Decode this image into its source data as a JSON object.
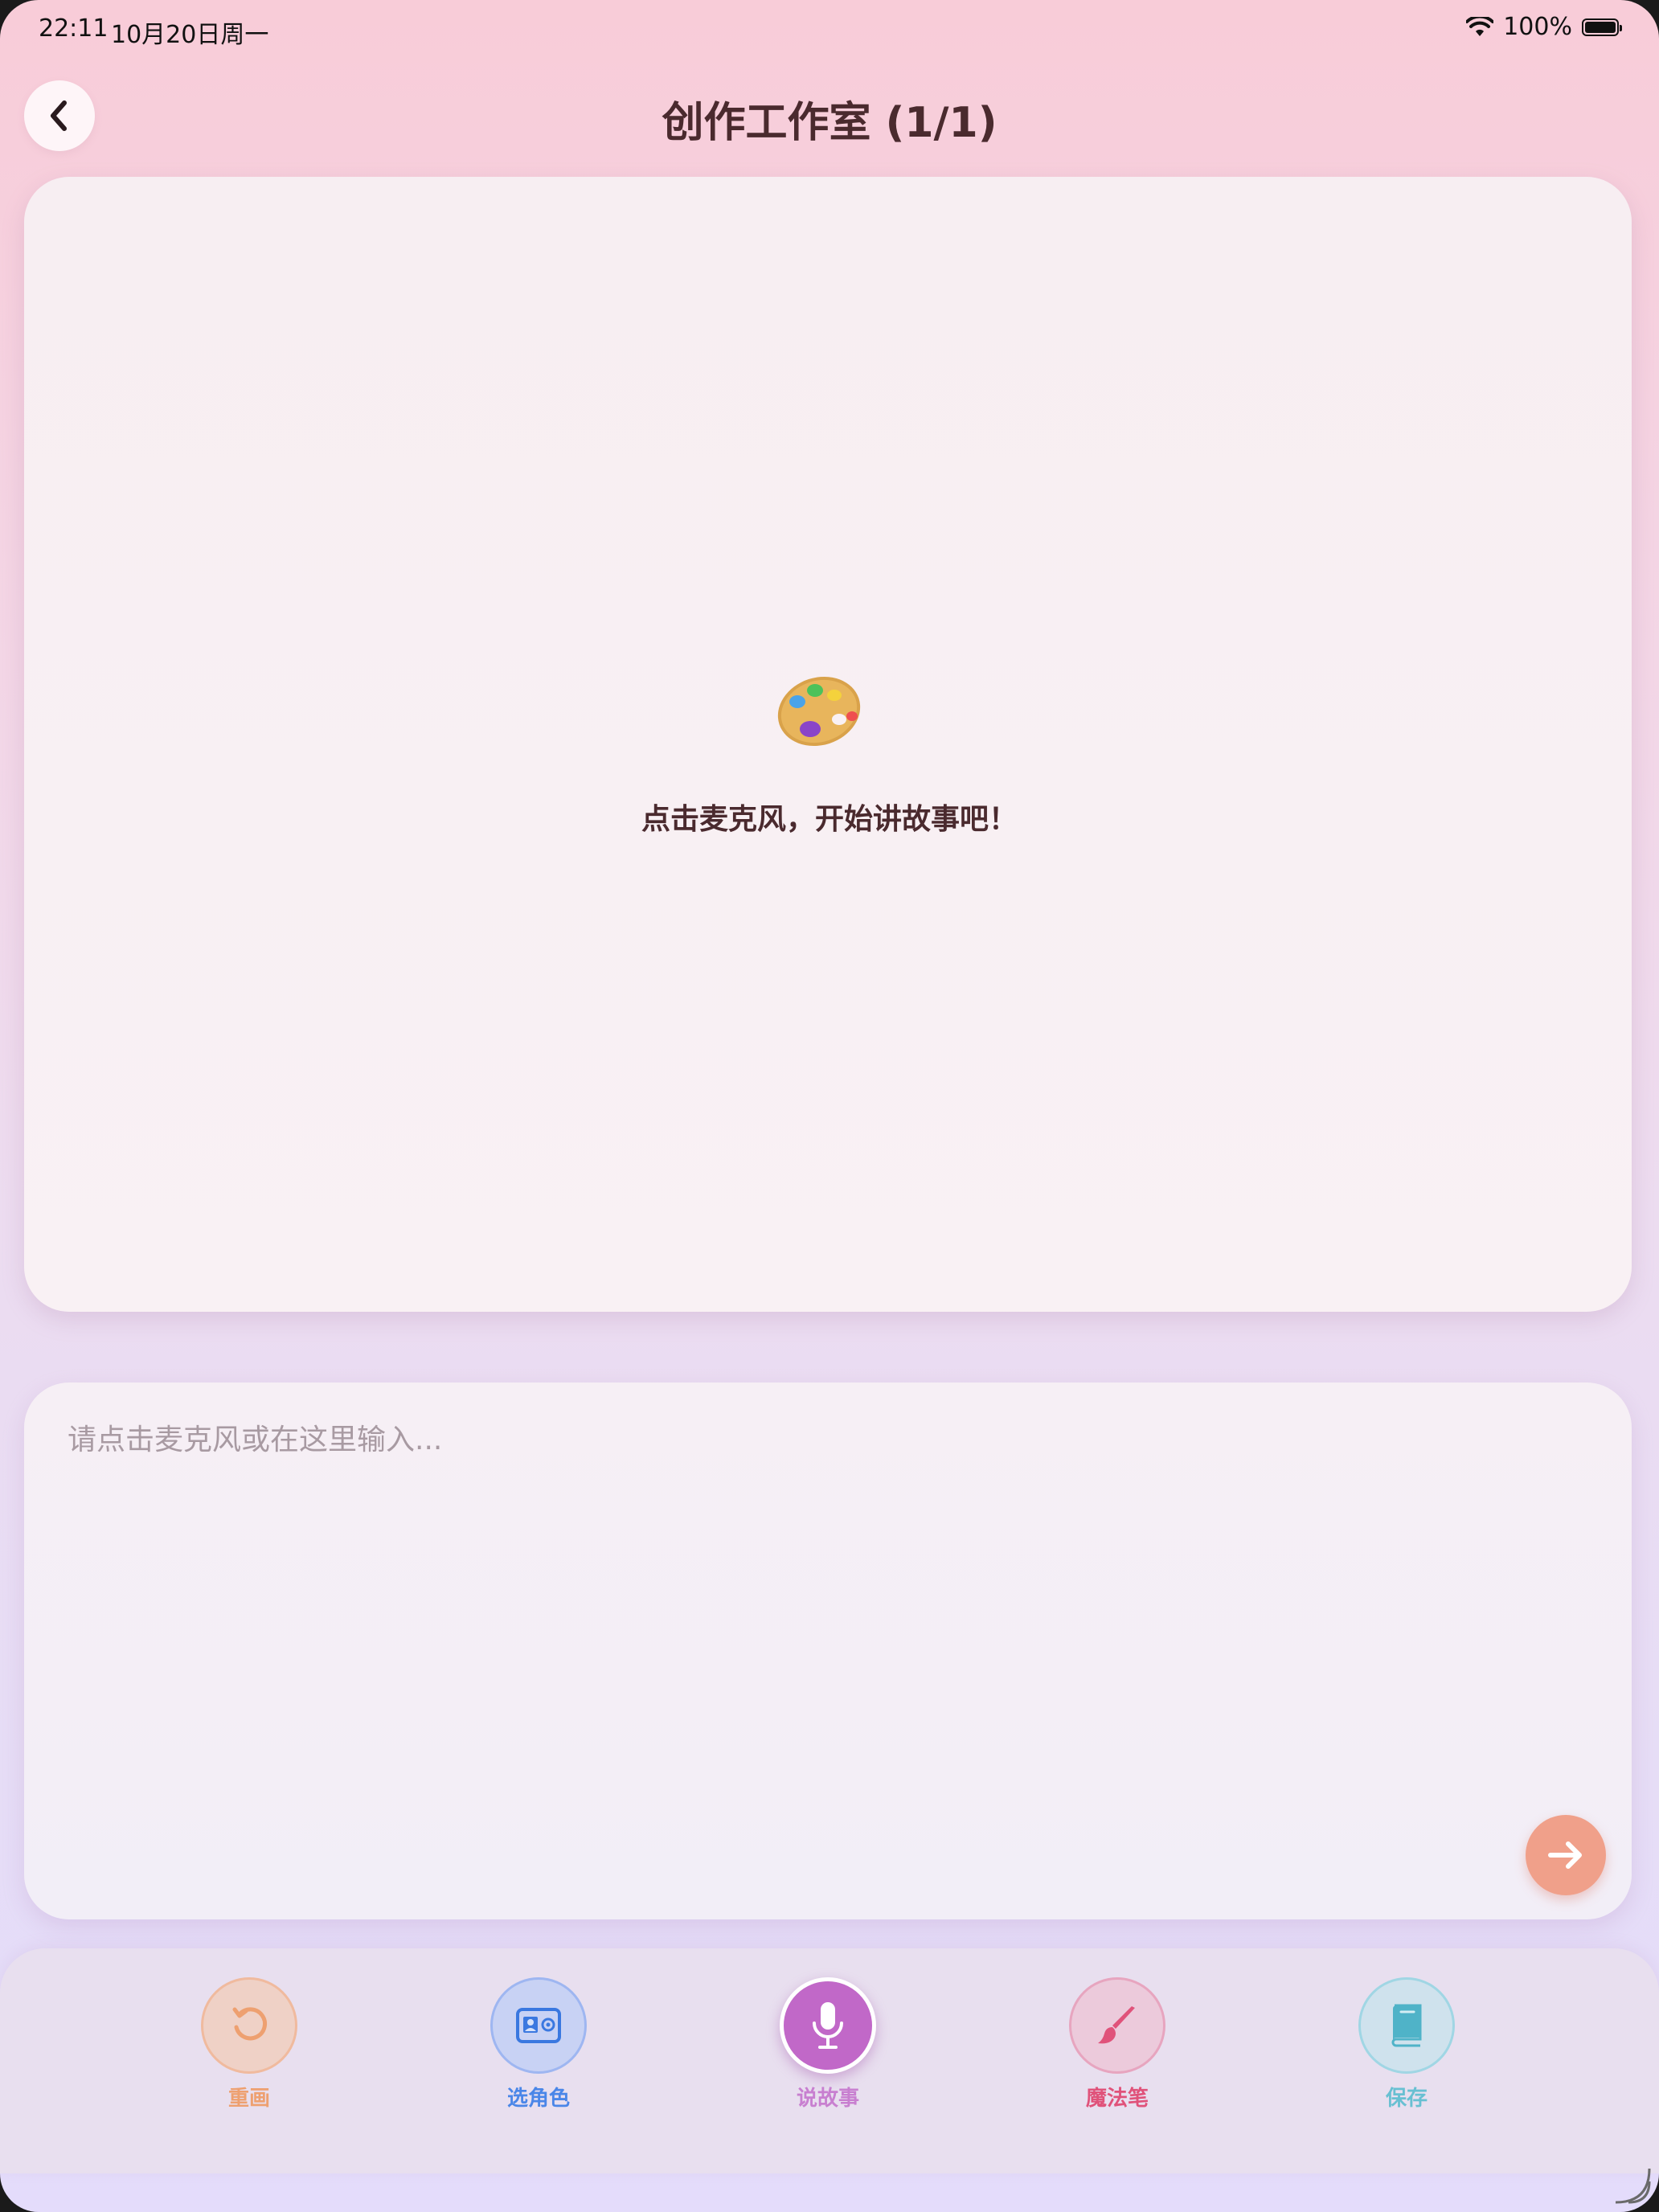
{
  "status_bar": {
    "time": "22:11",
    "date": "10月20日周一",
    "battery": "100%"
  },
  "header": {
    "title": "创作工作室 (1/1)",
    "back_icon": "chevron-left-icon"
  },
  "canvas": {
    "icon": "palette-icon",
    "hint": "点击麦克风，开始讲故事吧！"
  },
  "input": {
    "value": "",
    "placeholder": "请点击麦克风或在这里输入...",
    "send_icon": "arrow-right-icon"
  },
  "toolbar": {
    "items": [
      {
        "label": "重画",
        "icon": "undo-icon",
        "color": "#eea070"
      },
      {
        "label": "选角色",
        "icon": "contact-card-icon",
        "color": "#4a86e8"
      },
      {
        "label": "说故事",
        "icon": "microphone-icon",
        "color": "#c168c8"
      },
      {
        "label": "魔法笔",
        "icon": "paintbrush-icon",
        "color": "#e0527a"
      },
      {
        "label": "保存",
        "icon": "book-icon",
        "color": "#68c0d2"
      }
    ]
  },
  "colors": {
    "title_text": "#4a2a2e",
    "send_button": "#f0a08a",
    "background_top": "#f8ccd8",
    "background_bottom": "#e4dcfb"
  }
}
